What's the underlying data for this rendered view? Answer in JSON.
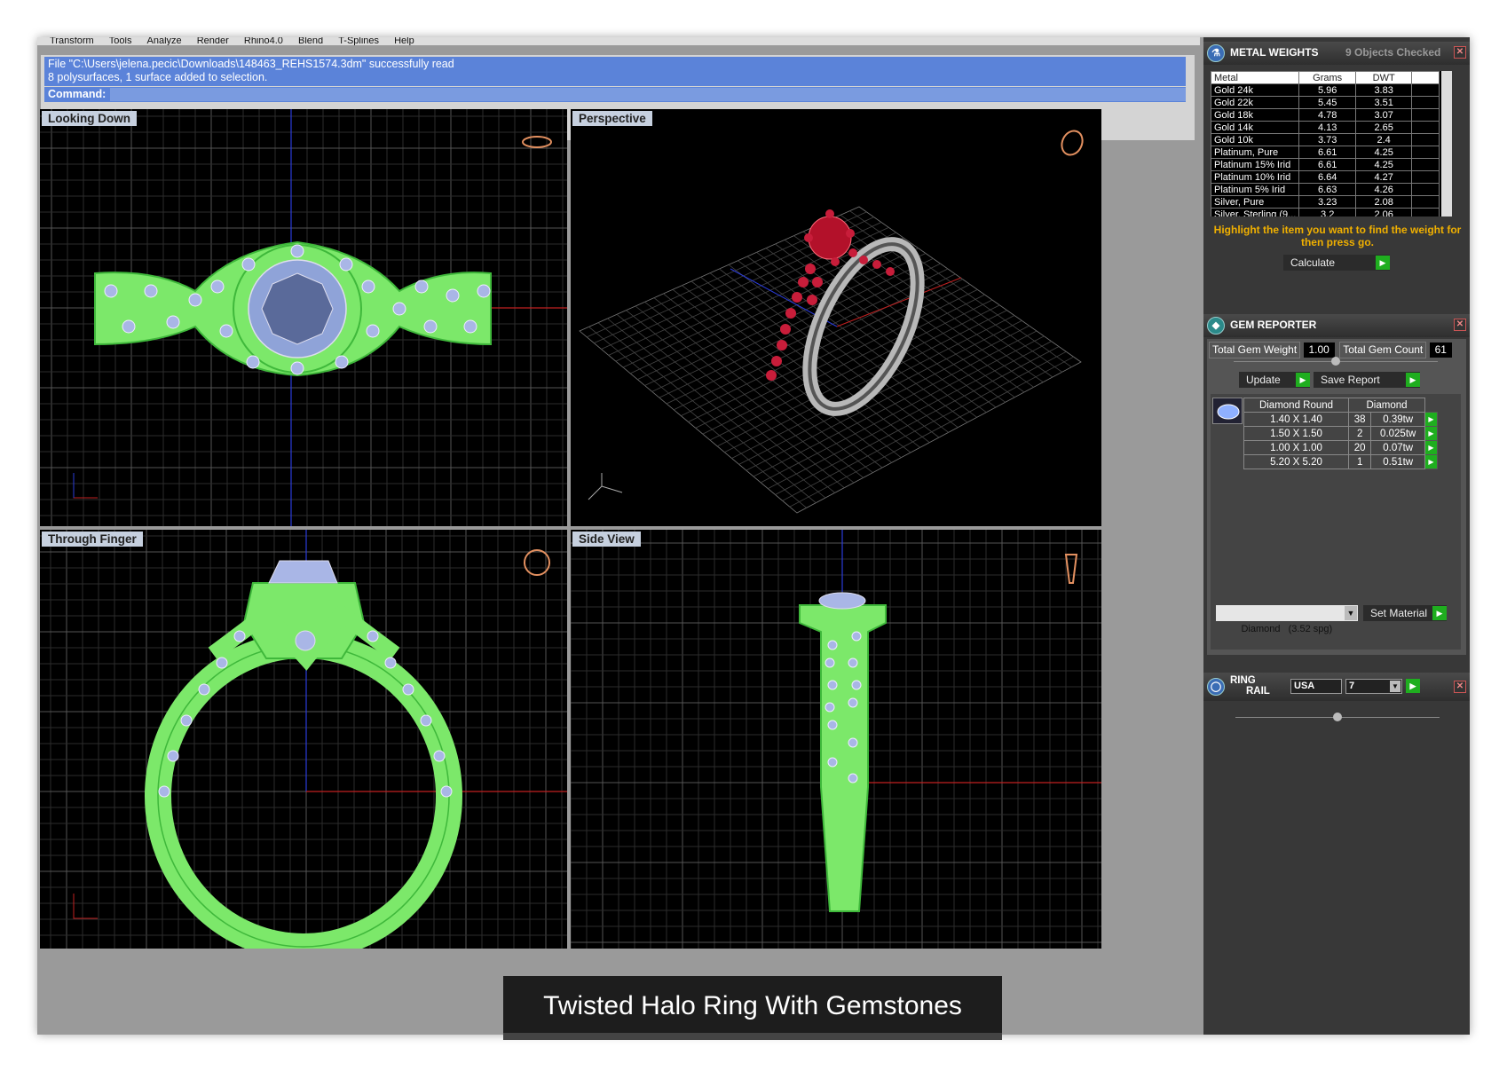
{
  "menu": [
    "Transform",
    "Tools",
    "Analyze",
    "Render",
    "Rhino4.0",
    "Blend",
    "T-Splines",
    "Help"
  ],
  "command": {
    "history": [
      "File \"C:\\Users\\jelena.pecic\\Downloads\\148463_REHS1574.3dm\" successfully read",
      "8 polysurfaces, 1 surface added to selection."
    ],
    "prompt": "Command:"
  },
  "viewports": {
    "top_left": "Looking Down",
    "top_right": "Perspective",
    "bottom_left": "Through Finger",
    "bottom_right": "Side View"
  },
  "metal_panel": {
    "title": "METAL WEIGHTS",
    "status": "9 Objects Checked",
    "columns": [
      "Metal",
      "Grams",
      "DWT"
    ],
    "rows": [
      [
        "Gold 24k",
        "5.96",
        "3.83"
      ],
      [
        "Gold 22k",
        "5.45",
        "3.51"
      ],
      [
        "Gold 18k",
        "4.78",
        "3.07"
      ],
      [
        "Gold 14k",
        "4.13",
        "2.65"
      ],
      [
        "Gold 10k",
        "3.73",
        "2.4"
      ],
      [
        "Platinum, Pure",
        "6.61",
        "4.25"
      ],
      [
        "Platinum 15% Irid",
        "6.61",
        "4.25"
      ],
      [
        "Platinum 10% Irid",
        "6.64",
        "4.27"
      ],
      [
        "Platinum 5% Irid",
        "6.63",
        "4.26"
      ],
      [
        "Silver, Pure",
        "3.23",
        "2.08"
      ],
      [
        "Silver, Sterling (9...",
        "3.2",
        "2.06"
      ]
    ],
    "hint": "Highlight the item you want to find the weight for then press go.",
    "calculate": "Calculate"
  },
  "gem_panel": {
    "title": "GEM REPORTER",
    "total_weight_label": "Total Gem Weight",
    "total_weight": "1.00",
    "total_count_label": "Total Gem Count",
    "total_count": "61",
    "update": "Update",
    "save": "Save Report",
    "headers": [
      "Diamond Round",
      "Diamond"
    ],
    "rows": [
      [
        "1.40 X 1.40",
        "38",
        "0.39tw"
      ],
      [
        "1.50 X 1.50",
        "2",
        "0.025tw"
      ],
      [
        "1.00 X 1.00",
        "20",
        "0.07tw"
      ],
      [
        "5.20 X 5.20",
        "1",
        "0.51tw"
      ]
    ],
    "material": "Diamond   (3.52 spg)",
    "set_material": "Set Material"
  },
  "ring_rail": {
    "title_line1": "RING",
    "title_line2": "RAIL",
    "region": "USA",
    "size": "7"
  },
  "caption": "Twisted Halo Ring With Gemstones"
}
